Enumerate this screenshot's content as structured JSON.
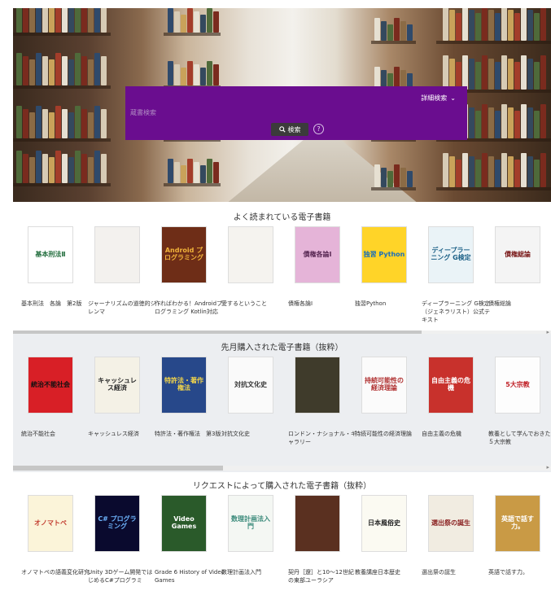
{
  "search": {
    "advanced_label": "詳細検索",
    "placeholder": "蔵書検索",
    "button_label": "検索",
    "help_label": "?"
  },
  "sections": [
    {
      "title": "よく読まれている電子書籍",
      "books": [
        {
          "cover_text": "基本刑法Ⅱ",
          "caption": "基本刑法　各論　第2版",
          "bg": "#ffffff",
          "fg": "#1e6b3a"
        },
        {
          "cover_text": "",
          "caption": "ジャーナリズムの道徳的ジレンマ",
          "bg": "#f3f1ee",
          "fg": "#b5282e"
        },
        {
          "cover_text": "Android プログラミング",
          "caption": "作ればわかる！Androidプログラミング Kotlin対応",
          "bg": "#6e2d17",
          "fg": "#f2b43a"
        },
        {
          "cover_text": "",
          "caption": "愛するということ",
          "bg": "#f5f3ef",
          "fg": "#999"
        },
        {
          "cover_text": "債権各論Ⅰ",
          "caption": "債権各論Ⅰ",
          "bg": "#e5b4d8",
          "fg": "#5a2a55"
        },
        {
          "cover_text": "独習 Python",
          "caption": "独習Python",
          "bg": "#ffd428",
          "fg": "#1b6fb8"
        },
        {
          "cover_text": "ディープラーニング G検定",
          "caption": "ディープラーニング G検定（ジェネラリスト）公式テキスト",
          "bg": "#eaf3f7",
          "fg": "#1a5f86"
        },
        {
          "cover_text": "債権総論",
          "caption": "債権総論",
          "bg": "#f4f4f4",
          "fg": "#7a1a1a"
        }
      ]
    },
    {
      "title": "先月購入された電子書籍（抜粋）",
      "books": [
        {
          "cover_text": "統治不能社会",
          "caption": "統治不能社会",
          "bg": "#d81f26",
          "fg": "#111111"
        },
        {
          "cover_text": "キャッシュレス経済",
          "caption": "キャッシュレス経済",
          "bg": "#f4f1e6",
          "fg": "#2b2b2b"
        },
        {
          "cover_text": "特許法・著作権法",
          "caption": "特許法・著作権法　第3版",
          "bg": "#27488a",
          "fg": "#f3d54a"
        },
        {
          "cover_text": "対抗文化史",
          "caption": "対抗文化史",
          "bg": "#fafafa",
          "fg": "#333333"
        },
        {
          "cover_text": "",
          "caption": "ロンドン・ナショナル・ギャラリー",
          "bg": "#3f3b2b",
          "fg": "#e8d9a8"
        },
        {
          "cover_text": "持続可能性の経済理論",
          "caption": "持続可能性の経済理論",
          "bg": "#fbfbfb",
          "fg": "#b03030"
        },
        {
          "cover_text": "自由主義の危機",
          "caption": "自由主義の危機",
          "bg": "#c8312c",
          "fg": "#ffffff"
        },
        {
          "cover_text": "5大宗教",
          "caption": "教養として学んでおきたい５大宗教",
          "bg": "#fdfdfd",
          "fg": "#c01f25"
        }
      ]
    },
    {
      "title": "リクエストによって購入された電子書籍（抜粋）",
      "books": [
        {
          "cover_text": "オノマトペ",
          "caption": "オノマトペの語義変化研究",
          "bg": "#fbf4d9",
          "fg": "#c23b2e"
        },
        {
          "cover_text": "C# プログラミング",
          "caption": "Unity 3Dゲーム開発ではじめるC#プログラミ",
          "bg": "#0a0a2e",
          "fg": "#6fb6ff"
        },
        {
          "cover_text": "Video Games",
          "caption": "Grade 6 History of Video Games",
          "bg": "#2a5a2a",
          "fg": "#ffffff"
        },
        {
          "cover_text": "数理計画法入門",
          "caption": "数理計画法入門",
          "bg": "#f4f7f3",
          "fg": "#3a8a7a"
        },
        {
          "cover_text": "",
          "caption": "契丹［遼］と10～12世紀の東部ユーラシア",
          "bg": "#5a3020",
          "fg": "#f2e0b0"
        },
        {
          "cover_text": "日本風俗史",
          "caption": "教養講座日本歴史",
          "bg": "#fbfaf2",
          "fg": "#222222"
        },
        {
          "cover_text": "選出祭の誕生",
          "caption": "選出祭の誕生",
          "bg": "#f1ece1",
          "fg": "#8a2020"
        },
        {
          "cover_text": "英語で話す力。",
          "caption": "英語で話す力。",
          "bg": "#c99a45",
          "fg": "#ffffff"
        }
      ]
    }
  ],
  "scroll": {
    "section1_thumb_fraction": 0.76,
    "section2_thumb_fraction": 0.39
  },
  "colors": {
    "search_panel": "#6a0d8f",
    "search_button": "#3b3b3b",
    "section_alt_bg": "#eceef1"
  },
  "icons": {
    "advanced": "chevron-down-icon",
    "search_button": "magnifier-icon",
    "help": "question-circle-icon",
    "scroll_right": "chevron-right-icon"
  }
}
